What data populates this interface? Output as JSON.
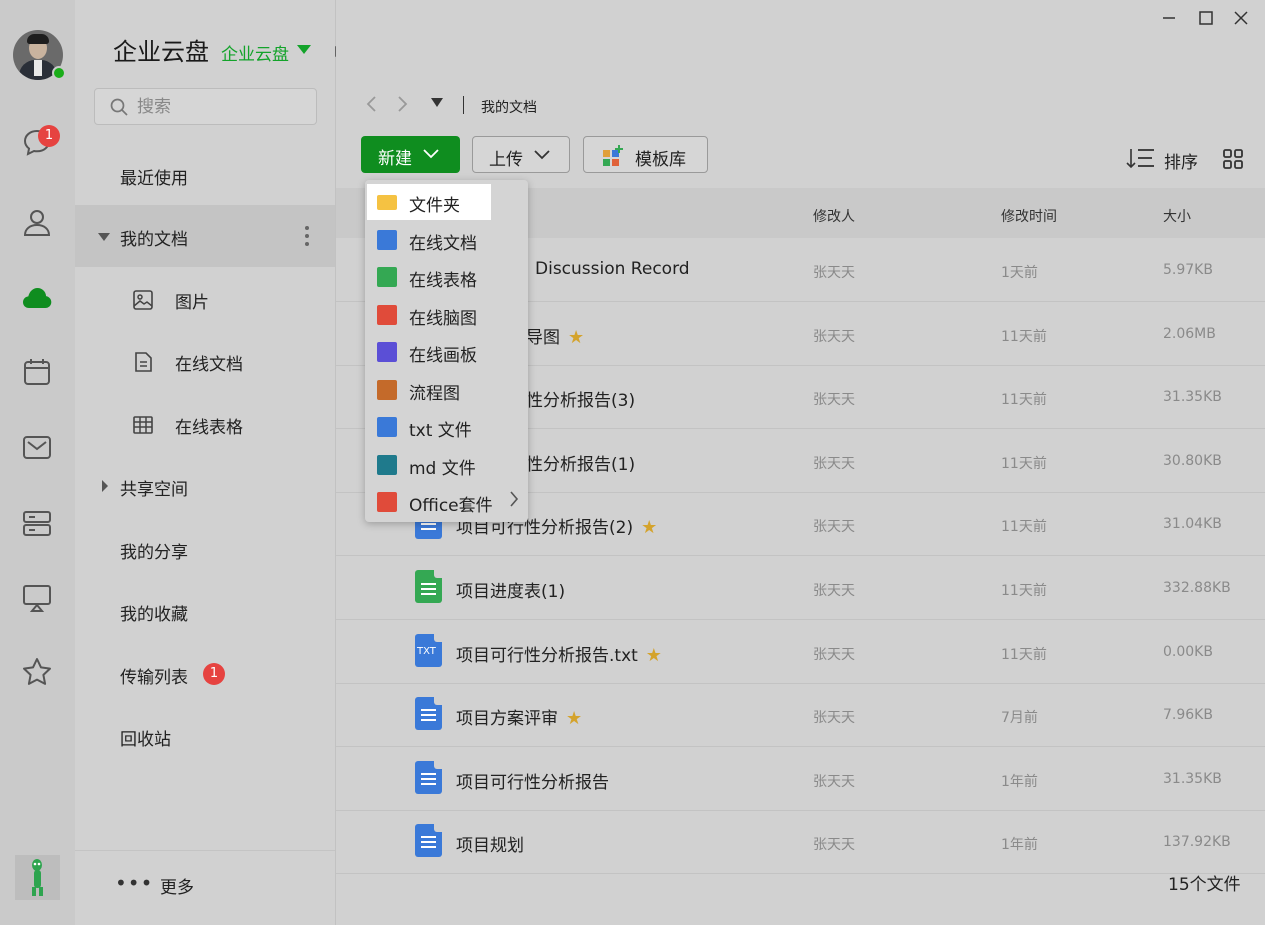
{
  "app": {
    "title": "企业云盘",
    "subtitle": "企业云盘",
    "brand_color": "#13a32a"
  },
  "rail": {
    "chat_badge": "1",
    "icons": [
      "chat-icon",
      "contacts-icon",
      "cloud-icon",
      "calendar-icon",
      "mail-icon",
      "server-icon",
      "screen-share-icon",
      "star-icon"
    ]
  },
  "search": {
    "placeholder": "搜索"
  },
  "sidebar": {
    "recent": "最近使用",
    "my_docs": "我的文档",
    "images": "图片",
    "online_docs": "在线文档",
    "online_sheets": "在线表格",
    "shared_space": "共享空间",
    "my_shares": "我的分享",
    "my_favorites": "我的收藏",
    "transfer_list": "传输列表",
    "transfer_badge": "1",
    "recycle_bin": "回收站",
    "more": "更多"
  },
  "breadcrumb": {
    "current": "我的文档"
  },
  "toolbar": {
    "new_label": "新建",
    "upload_label": "上传",
    "template_label": "模板库",
    "sort_label": "排序"
  },
  "table": {
    "columns": {
      "modifier": "修改人",
      "modified_time": "修改时间",
      "size": "大小"
    },
    "rows": [
      {
        "name": "Discussion Record",
        "user": "张天天",
        "time": "1天前",
        "size": "5.97KB",
        "starred": false,
        "type": "doc"
      },
      {
        "name": "导图",
        "user": "张天天",
        "time": "11天前",
        "size": "2.06MB",
        "starred": true,
        "type": "mindmap"
      },
      {
        "name": "性分析报告(3)",
        "user": "张天天",
        "time": "11天前",
        "size": "31.35KB",
        "starred": false,
        "type": "doc"
      },
      {
        "name": "性分析报告(1)",
        "user": "张天天",
        "time": "11天前",
        "size": "30.80KB",
        "starred": false,
        "type": "doc"
      },
      {
        "name": "项目可行性分析报告(2)",
        "user": "张天天",
        "time": "11天前",
        "size": "31.04KB",
        "starred": true,
        "type": "doc"
      },
      {
        "name": "项目进度表(1)",
        "user": "张天天",
        "time": "11天前",
        "size": "332.88KB",
        "starred": false,
        "type": "sheet"
      },
      {
        "name": "项目可行性分析报告.txt",
        "user": "张天天",
        "time": "11天前",
        "size": "0.00KB",
        "starred": true,
        "type": "txt"
      },
      {
        "name": "项目方案评审",
        "user": "张天天",
        "time": "7月前",
        "size": "7.96KB",
        "starred": true,
        "type": "doc"
      },
      {
        "name": "项目可行性分析报告",
        "user": "张天天",
        "time": "1年前",
        "size": "31.35KB",
        "starred": false,
        "type": "doc"
      },
      {
        "name": "项目规划",
        "user": "张天天",
        "time": "1年前",
        "size": "137.92KB",
        "starred": false,
        "type": "doc"
      }
    ]
  },
  "file_count": "15个文件",
  "dropdown": {
    "items": [
      {
        "label": "文件夹",
        "icon": "folder-icon"
      },
      {
        "label": "在线文档",
        "icon": "online-doc-icon"
      },
      {
        "label": "在线表格",
        "icon": "online-sheet-icon"
      },
      {
        "label": "在线脑图",
        "icon": "mindmap-icon"
      },
      {
        "label": "在线画板",
        "icon": "whiteboard-icon"
      },
      {
        "label": "流程图",
        "icon": "flowchart-icon"
      },
      {
        "label": "txt 文件",
        "icon": "txt-file-icon"
      },
      {
        "label": "md 文件",
        "icon": "md-file-icon"
      },
      {
        "label": "Office套件",
        "icon": "office-icon"
      }
    ]
  }
}
